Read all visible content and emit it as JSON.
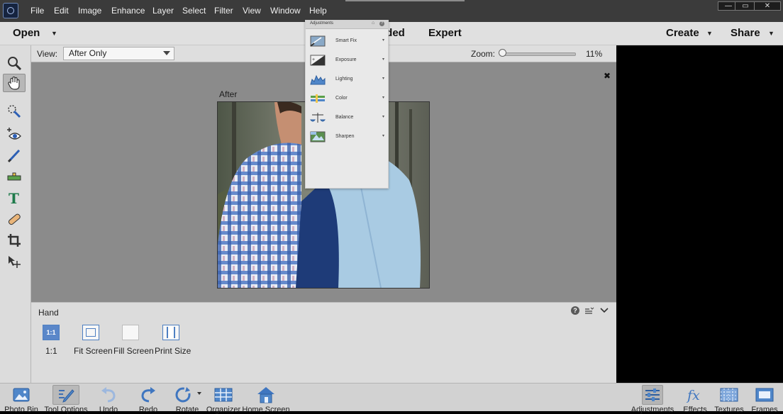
{
  "menubar": {
    "items": [
      "File",
      "Edit",
      "Image",
      "Enhance",
      "Layer",
      "Select",
      "Filter",
      "View",
      "Window",
      "Help"
    ],
    "window_controls": {
      "minimize": "—",
      "maximize": "▭",
      "close": "✕"
    }
  },
  "modebar": {
    "open_label": "Open",
    "mode_partial_label": "ided",
    "expert_label": "Expert",
    "create_label": "Create",
    "share_label": "Share"
  },
  "viewbar": {
    "view_label": "View:",
    "view_value": "After Only",
    "zoom_label": "Zoom:",
    "zoom_value": "11%",
    "zoom_fraction": 0.02
  },
  "canvas": {
    "after_label": "After",
    "close_glyph": "✖"
  },
  "tools": [
    {
      "name": "zoom",
      "icon": "magnifier-icon"
    },
    {
      "name": "hand",
      "icon": "hand-icon",
      "selected": true
    },
    {
      "name": "quick-selection",
      "icon": "quick-selection-icon"
    },
    {
      "name": "red-eye",
      "icon": "eye-icon"
    },
    {
      "name": "whiten-teeth",
      "icon": "brush-icon"
    },
    {
      "name": "straighten",
      "icon": "level-icon"
    },
    {
      "name": "type",
      "icon": "text-icon"
    },
    {
      "name": "spot-healing",
      "icon": "bandage-icon"
    },
    {
      "name": "crop",
      "icon": "crop-icon"
    },
    {
      "name": "move",
      "icon": "move-icon"
    }
  ],
  "tool_options": {
    "tool_name": "Hand",
    "help_glyph": "?",
    "options": [
      {
        "icon_text": "1:1",
        "label": "1:1"
      },
      {
        "icon_text": "",
        "label": "Fit Screen"
      },
      {
        "icon_text": "",
        "label": "Fill Screen"
      },
      {
        "icon_text": "",
        "label": "Print Size"
      }
    ]
  },
  "bottombar": {
    "left": [
      {
        "label": "Photo Bin",
        "icon": "photo-bin-icon"
      },
      {
        "label": "Tool Options",
        "icon": "tool-options-icon"
      },
      {
        "label": "Undo",
        "icon": "undo-icon"
      },
      {
        "label": "Redo",
        "icon": "redo-icon"
      },
      {
        "label": "Rotate",
        "icon": "rotate-icon"
      },
      {
        "label": "Organizer",
        "icon": "organizer-icon"
      },
      {
        "label": "Home Screen",
        "icon": "home-icon"
      }
    ],
    "right": [
      {
        "label": "Adjustments",
        "icon": "adjustments-icon"
      },
      {
        "label": "Effects",
        "icon": "fx-icon"
      },
      {
        "label": "Textures",
        "icon": "textures-icon"
      },
      {
        "label": "Frames",
        "icon": "frames-icon"
      }
    ]
  },
  "adjustments_panel": {
    "title": "Adjustments",
    "items": [
      {
        "label": "Smart Fix",
        "icon": "smart-fix-icon"
      },
      {
        "label": "Exposure",
        "icon": "exposure-icon"
      },
      {
        "label": "Lighting",
        "icon": "lighting-icon"
      },
      {
        "label": "Color",
        "icon": "color-icon"
      },
      {
        "label": "Balance",
        "icon": "balance-icon"
      },
      {
        "label": "Sharpen",
        "icon": "sharpen-icon"
      }
    ],
    "arrow_glyph": "▾"
  }
}
